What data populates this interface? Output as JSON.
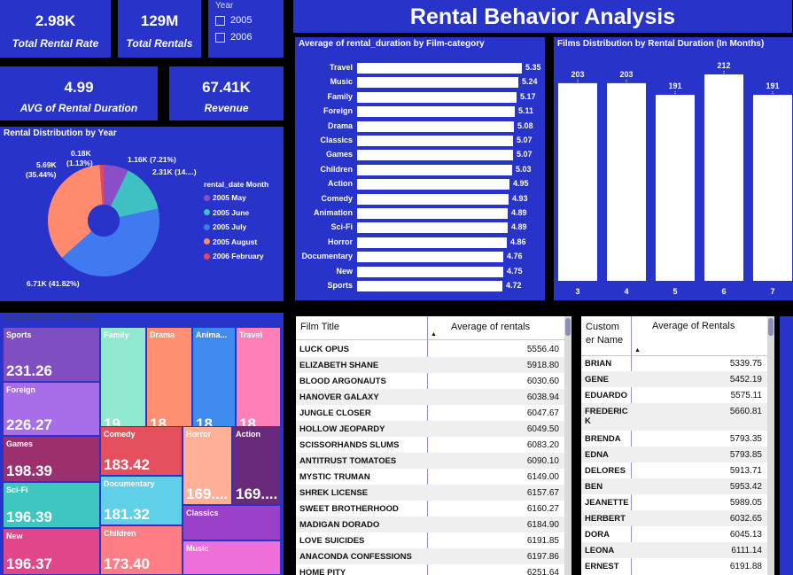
{
  "title": "Rental Behavior Analysis",
  "kpis": {
    "total_rental_rate": {
      "value": "2.98K",
      "label": "Total Rental Rate"
    },
    "total_rentals": {
      "value": "129M",
      "label": "Total Rentals"
    },
    "avg_rental_duration": {
      "value": "4.99",
      "label": "AVG of Rental Duration"
    },
    "revenue": {
      "value": "67.41K",
      "label": "Revenue"
    }
  },
  "year_slicer": {
    "title": "Year",
    "options": [
      "2005",
      "2006"
    ]
  },
  "colors": {
    "panel": "#2733c9",
    "background": "#000000",
    "bar": "#ffffff"
  },
  "pie": {
    "title": "Rental Distribution by Year",
    "legend_title": "rental_date Month",
    "slices": [
      {
        "label": "2005 May",
        "color": "#8a4fc7",
        "pct": 7.21,
        "text": "1.16K (7.21%)"
      },
      {
        "label": "2005 June",
        "color": "#3fc1c4",
        "pct": 14.4,
        "text": "2.31K (14....)"
      },
      {
        "label": "2005 July",
        "color": "#3f7af0",
        "pct": 41.82,
        "text": "6.71K (41.82%)"
      },
      {
        "label": "2005 August",
        "color": "#ff8a6e",
        "pct": 35.44,
        "text_line1": "5.69K",
        "text_line2": "(35.44%)"
      },
      {
        "label": "2006 February",
        "color": "#e0466a",
        "pct": 1.13,
        "text_line1": "0.18K",
        "text_line2": "(1.13%)"
      }
    ]
  },
  "duration_by_category": {
    "title": "Average of rental_duration by Film-category",
    "xmax": 5.35,
    "items": [
      {
        "label": "Travel",
        "value": 5.35
      },
      {
        "label": "Music",
        "value": 5.24
      },
      {
        "label": "Family",
        "value": 5.17
      },
      {
        "label": "Foreign",
        "value": 5.11
      },
      {
        "label": "Drama",
        "value": 5.08
      },
      {
        "label": "Classics",
        "value": 5.07
      },
      {
        "label": "Games",
        "value": 5.07
      },
      {
        "label": "Children",
        "value": 5.03
      },
      {
        "label": "Action",
        "value": 4.95
      },
      {
        "label": "Comedy",
        "value": 4.93
      },
      {
        "label": "Animation",
        "value": 4.89
      },
      {
        "label": "Sci-Fi",
        "value": 4.89
      },
      {
        "label": "Horror",
        "value": 4.86
      },
      {
        "label": "Documentary",
        "value": 4.76
      },
      {
        "label": "New",
        "value": 4.75
      },
      {
        "label": "Sports",
        "value": 4.72
      }
    ]
  },
  "chart_data": {
    "type": "bar",
    "title": "Films Distribution by Rental Duration (In Months)",
    "categories": [
      "3",
      "4",
      "5",
      "6",
      "7"
    ],
    "values": [
      203,
      203,
      191,
      212,
      191
    ],
    "ylim": [
      0,
      212
    ],
    "grid": false
  },
  "treemap": {
    "title": "Rental Rates of Films",
    "cells": [
      {
        "name": "Sports",
        "value": "231.26",
        "color": "#7f4fc2"
      },
      {
        "name": "Foreign",
        "value": "226.27",
        "color": "#a86de8"
      },
      {
        "name": "Games",
        "value": "198.39",
        "color": "#9c2f6e"
      },
      {
        "name": "Sci-Fi",
        "value": "196.39",
        "color": "#3fc6c0"
      },
      {
        "name": "New",
        "value": "196.37",
        "color": "#e0478a"
      },
      {
        "name": "Family",
        "value": "19...",
        "color": "#8fe8cf"
      },
      {
        "name": "Drama",
        "value": "18...",
        "color": "#ff9172"
      },
      {
        "name": "Anima...",
        "value": "18...",
        "color": "#3f8bf0"
      },
      {
        "name": "Travel",
        "value": "18...",
        "color": "#ff7fb8"
      },
      {
        "name": "Comedy",
        "value": "183.42",
        "color": "#e5505e"
      },
      {
        "name": "Horror",
        "value": "169....",
        "color": "#ffb096"
      },
      {
        "name": "Action",
        "value": "169....",
        "color": "#6a2a7c"
      },
      {
        "name": "Documentary",
        "value": "181.32",
        "color": "#5fd0e8"
      },
      {
        "name": "Children",
        "value": "173.40",
        "color": "#ff7e86"
      },
      {
        "name": "Classics",
        "value": "",
        "color": "#9b40c8"
      },
      {
        "name": "Music",
        "value": "",
        "color": "#ef6fd8"
      }
    ]
  },
  "film_table": {
    "headers": [
      "Film Title",
      "Average of rentals"
    ],
    "rows": [
      [
        "LUCK OPUS",
        "5556.40"
      ],
      [
        "ELIZABETH SHANE",
        "5918.80"
      ],
      [
        "BLOOD ARGONAUTS",
        "6030.60"
      ],
      [
        "HANOVER GALAXY",
        "6038.94"
      ],
      [
        "JUNGLE CLOSER",
        "6047.67"
      ],
      [
        "HOLLOW JEOPARDY",
        "6049.50"
      ],
      [
        "SCISSORHANDS SLUMS",
        "6083.20"
      ],
      [
        "ANTITRUST TOMATOES",
        "6090.10"
      ],
      [
        "MYSTIC TRUMAN",
        "6149.00"
      ],
      [
        "SHREK LICENSE",
        "6157.67"
      ],
      [
        "SWEET BROTHERHOOD",
        "6160.27"
      ],
      [
        "MADIGAN DORADO",
        "6184.90"
      ],
      [
        "LOVE SUICIDES",
        "6191.85"
      ],
      [
        "ANACONDA CONFESSIONS",
        "6197.86"
      ],
      [
        "HOME PITY",
        "6251.64"
      ]
    ]
  },
  "customer_table": {
    "headers": [
      "Custom er Name",
      "Average of Rentals"
    ],
    "rows": [
      [
        "BRIAN",
        "5339.75"
      ],
      [
        "GENE",
        "5452.19"
      ],
      [
        "EDUARDO",
        "5575.11"
      ],
      [
        "FREDERIC K",
        "5660.81"
      ],
      [
        "BRENDA",
        "5793.35"
      ],
      [
        "EDNA",
        "5793.85"
      ],
      [
        "DELORES",
        "5913.71"
      ],
      [
        "BEN",
        "5953.42"
      ],
      [
        "JEANETTE",
        "5989.05"
      ],
      [
        "HERBERT",
        "6032.65"
      ],
      [
        "DORA",
        "6045.13"
      ],
      [
        "LEONA",
        "6111.14"
      ],
      [
        "ERNEST",
        "6191.88"
      ]
    ]
  }
}
